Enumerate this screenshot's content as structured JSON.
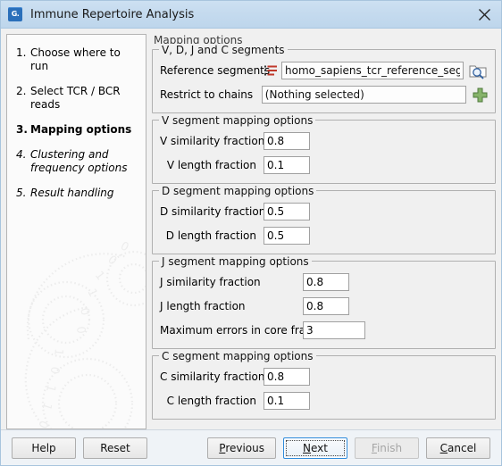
{
  "window": {
    "title": "Immune Repertoire Analysis",
    "app_icon": "clc-workbench-icon",
    "close_icon": "close-icon"
  },
  "sidebar": {
    "steps": [
      {
        "num": "1.",
        "label": "Choose where to run",
        "state": "done"
      },
      {
        "num": "2.",
        "label": "Select TCR / BCR reads",
        "state": "done"
      },
      {
        "num": "3.",
        "label": "Mapping options",
        "state": "current"
      },
      {
        "num": "4.",
        "label": "Clustering and frequency options",
        "state": "future"
      },
      {
        "num": "5.",
        "label": "Result handling",
        "state": "future"
      }
    ]
  },
  "main": {
    "panel_title": "Mapping options",
    "segments_group": {
      "title": "V, D, J and C segments",
      "reference_label": "Reference segments",
      "reference_value": "homo_sapiens_tcr_reference_segments",
      "reference_list_icon": "list-icon",
      "browse_icon": "folder-search-icon",
      "chains_label": "Restrict to chains",
      "chains_value": "(Nothing selected)",
      "add_icon": "plus-icon"
    },
    "v_group": {
      "title": "V segment mapping options",
      "fields": [
        {
          "label": "V similarity fraction",
          "value": "0.8"
        },
        {
          "label": "V length fraction",
          "value": "0.1"
        }
      ]
    },
    "d_group": {
      "title": "D segment mapping options",
      "fields": [
        {
          "label": "D similarity fraction",
          "value": "0.5"
        },
        {
          "label": "D length fraction",
          "value": "0.5"
        }
      ]
    },
    "j_group": {
      "title": "J segment mapping options",
      "fields": [
        {
          "label": "J similarity fraction",
          "value": "0.8"
        },
        {
          "label": "J length fraction",
          "value": "0.8"
        },
        {
          "label": "Maximum errors in core fragment",
          "value": "3"
        }
      ]
    },
    "c_group": {
      "title": "C segment mapping options",
      "fields": [
        {
          "label": "C similarity fraction",
          "value": "0.8"
        },
        {
          "label": "C length fraction",
          "value": "0.1"
        }
      ]
    }
  },
  "footer": {
    "help": "Help",
    "reset": "Reset",
    "previous": {
      "pre": "",
      "key": "P",
      "post": "revious"
    },
    "next": {
      "pre": "",
      "key": "N",
      "post": "ext"
    },
    "finish": {
      "pre": "",
      "key": "F",
      "post": "inish"
    },
    "cancel": {
      "pre": "",
      "key": "C",
      "post": "ancel"
    }
  },
  "colors": {
    "titlebar": "#c4daee",
    "accent_focus": "#2e8bdb",
    "list_icon_red": "#c0392b",
    "plus_green": "#7aa85c"
  }
}
